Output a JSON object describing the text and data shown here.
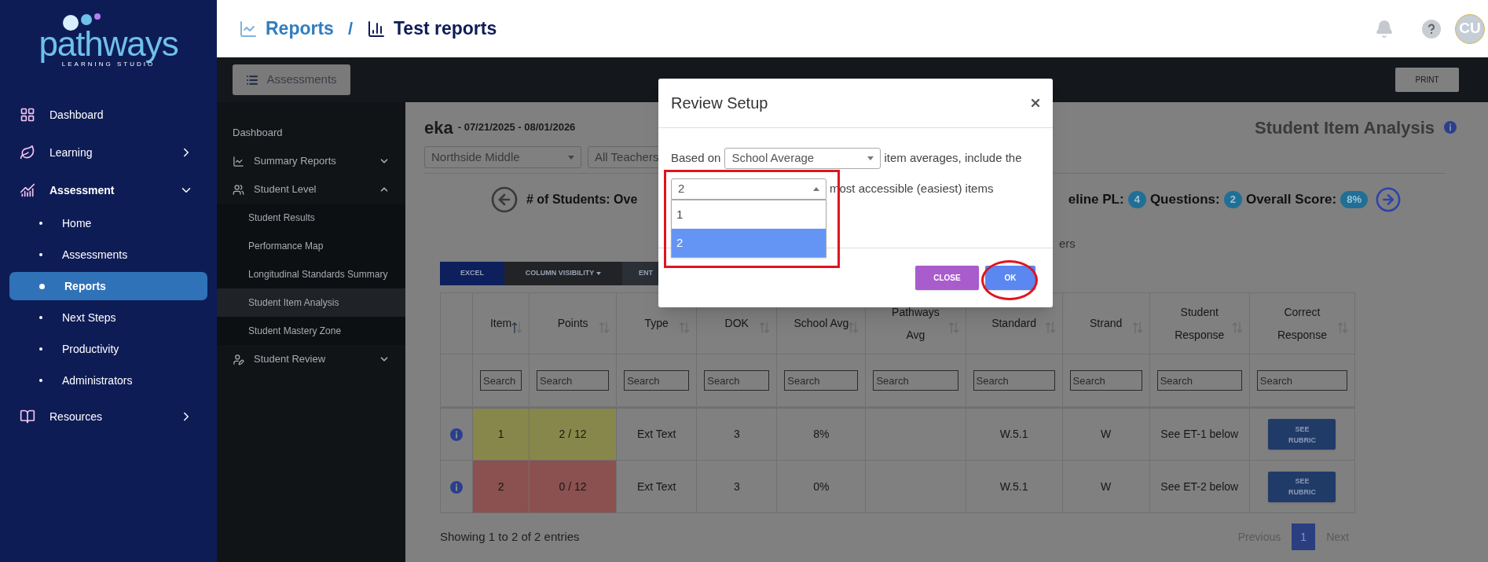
{
  "sidebar": {
    "logo": {
      "name": "pathways",
      "tagline": "LEARNING STUDIO"
    },
    "items": [
      {
        "label": "Dashboard",
        "kind": "link"
      },
      {
        "label": "Learning",
        "kind": "group",
        "expanded": false
      },
      {
        "label": "Assessment",
        "kind": "group",
        "expanded": true,
        "children": [
          {
            "label": "Home",
            "selected": false
          },
          {
            "label": "Assessments",
            "selected": false
          },
          {
            "label": "Reports",
            "selected": true
          },
          {
            "label": "Next Steps",
            "selected": false
          },
          {
            "label": "Productivity",
            "selected": false
          },
          {
            "label": "Administrators",
            "selected": false
          }
        ]
      },
      {
        "label": "Resources",
        "kind": "group",
        "expanded": false
      }
    ]
  },
  "header": {
    "breadcrumbs": [
      {
        "label": "Reports"
      },
      {
        "label": "Test reports"
      }
    ],
    "separator": "/",
    "avatar": "CU"
  },
  "toolbar": {
    "assessments_button": "Assessments",
    "print_button": "PRINT"
  },
  "subnav": {
    "items": [
      {
        "label": "Dashboard",
        "kind": "link"
      },
      {
        "label": "Summary Reports",
        "kind": "group",
        "expanded": false
      },
      {
        "label": "Student Level",
        "kind": "group",
        "expanded": true,
        "children": [
          {
            "label": "Student Results",
            "selected": false
          },
          {
            "label": "Performance Map",
            "selected": false
          },
          {
            "label": "Longitudinal Standards Summary",
            "selected": false
          },
          {
            "label": "Student Item Analysis",
            "selected": true
          },
          {
            "label": "Student Mastery Zone",
            "selected": false
          }
        ]
      },
      {
        "label": "Student Review",
        "kind": "group",
        "expanded": false
      }
    ]
  },
  "report": {
    "title": "eka",
    "date_range": "- 07/21/2025 - 08/01/2026",
    "page_title": "Student Item Analysis",
    "filters": [
      "Northside Middle",
      "All Teachers"
    ],
    "stats_left": "# of Students: Ove",
    "stats_right": [
      {
        "label": "eline PL:",
        "value": "4"
      },
      {
        "label": "Questions:",
        "value": "2"
      },
      {
        "label": "Overall Score:",
        "value": "8%"
      }
    ],
    "note_fragment": "ers"
  },
  "table": {
    "buttons": [
      {
        "label": "EXCEL",
        "kind": "export"
      },
      {
        "label": "COLUMN VISIBILITY",
        "kind": "dropdown"
      },
      {
        "label": "ENT",
        "kind": "plain"
      }
    ],
    "columns": [
      {
        "label": "Item",
        "sorted": true,
        "search_placeholder": "Search"
      },
      {
        "label": "Points",
        "sorted": false,
        "search_placeholder": "Search"
      },
      {
        "label": "Type",
        "sorted": false,
        "search_placeholder": "Search"
      },
      {
        "label": "DOK",
        "sorted": false,
        "search_placeholder": "Search"
      },
      {
        "label": "School Avg",
        "sorted": false,
        "search_placeholder": "Search"
      },
      {
        "label": "Pathways Avg",
        "sorted": false,
        "search_placeholder": "Search"
      },
      {
        "label": "Standard",
        "sorted": false,
        "search_placeholder": "Search"
      },
      {
        "label": "Strand",
        "sorted": false,
        "search_placeholder": "Search"
      },
      {
        "label": "Student Response",
        "sorted": false,
        "search_placeholder": "Search"
      },
      {
        "label": "Correct Response",
        "sorted": false,
        "search_placeholder": "Search"
      }
    ],
    "rows": [
      {
        "color": "#87874b",
        "cells": [
          "1",
          "2 / 12",
          "Ext Text",
          "3",
          "8%",
          null,
          "W.5.1",
          "W",
          "See ET-1 below",
          "SEE RUBRIC"
        ]
      },
      {
        "color": "#8b5050",
        "cells": [
          "2",
          "0 / 12",
          "Ext Text",
          "3",
          "0%",
          null,
          "W.5.1",
          "W",
          "See ET-2 below",
          "SEE RUBRIC"
        ]
      }
    ],
    "info": "Showing 1 to 2 of 2 entries",
    "pagination": [
      {
        "label": "Previous",
        "selected": false
      },
      {
        "label": "1",
        "selected": true
      },
      {
        "label": "Next",
        "selected": false
      }
    ]
  },
  "dialog": {
    "title": "Review Setup",
    "based_on_label": "Based on",
    "source_select": "School Average",
    "after_select": "item averages, include the",
    "count_select": {
      "value": "2",
      "expanded": true,
      "options": [
        {
          "label": "1",
          "selected": false
        },
        {
          "label": "2",
          "selected": true
        }
      ]
    },
    "count_text": "most accessible (easiest) items",
    "buttons": [
      {
        "label": "CLOSE",
        "kind": "secondary"
      },
      {
        "label": "OK",
        "kind": "primary"
      }
    ]
  }
}
